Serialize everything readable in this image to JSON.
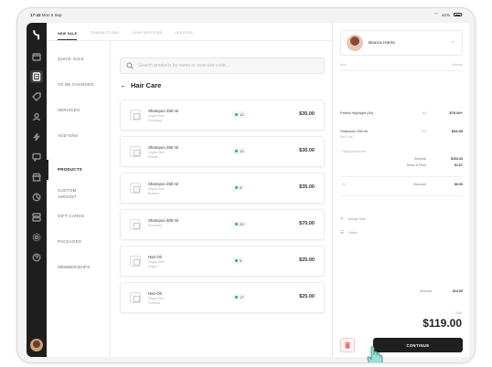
{
  "statusbar": {
    "time": "17:43",
    "date": "Mon 5 Sep",
    "battery": "41%"
  },
  "tabs": [
    {
      "label": "New Sale",
      "active": true
    },
    {
      "label": "Transactions",
      "active": false
    },
    {
      "label": "Cash Register",
      "active": false
    },
    {
      "label": "Invoices",
      "active": false
    }
  ],
  "categories": [
    {
      "label": "Quick Sale",
      "active": false
    },
    {
      "label": "To Be Charged",
      "active": false
    },
    {
      "label": "Services",
      "active": false
    },
    {
      "label": "Add-ons",
      "active": false
    },
    {
      "label": "Products",
      "active": true
    },
    {
      "label": "Custom Amount",
      "active": false
    },
    {
      "label": "Gift Cards",
      "active": false
    },
    {
      "label": "Packages",
      "active": false
    },
    {
      "label": "Memberships",
      "active": false
    }
  ],
  "search": {
    "placeholder": "Search products by name or scan bar code..."
  },
  "section": {
    "back_arrow": "←",
    "title": "Hair Care"
  },
  "products": [
    {
      "name": "Shampoo 250 ml",
      "brand": "Vegan Bee",
      "variant": "Everyday",
      "stock": "12",
      "price": "$35.00"
    },
    {
      "name": "Shampoo 250 ml",
      "brand": "Vegan Bee",
      "variant": "Repair",
      "stock": "10",
      "price": "$35.00"
    },
    {
      "name": "Shampoo 250 ml",
      "brand": "Vegan Bee",
      "variant": "Botanic",
      "stock": "8",
      "price": "$35.00"
    },
    {
      "name": "Shampoo 500 ml",
      "brand": "Everyday",
      "variant": "",
      "stock": "20",
      "price": "$70.00"
    },
    {
      "name": "Hair Oil",
      "brand": "Vegan Bee",
      "variant": "Argan",
      "stock": "6",
      "price": "$25.00"
    },
    {
      "name": "Hair Oil",
      "brand": "Vegan Bee",
      "variant": "Coconut",
      "stock": "17",
      "price": "$25.00"
    }
  ],
  "cart": {
    "client_name": "Bianca Harris",
    "close_glyph": "×",
    "col_item": "Item",
    "col_amount": "Amount",
    "lines": [
      {
        "name": "Partial Highlight (5h)",
        "qty": "x1",
        "amount": "$70.00+",
        "sub": ""
      },
      {
        "name": "Shampoo 250 ml",
        "qty": "x1",
        "amount": "$33.33",
        "sub": "Hair Care"
      }
    ],
    "promo_link": "+ Apply promo/code",
    "summary": [
      {
        "label": "Subtotal",
        "value": "$103.33"
      },
      {
        "label": "Taxes & Fees",
        "value": "$1.67"
      }
    ],
    "discount": {
      "icon": "%",
      "label": "Discount",
      "value": "$0.00"
    },
    "options": [
      {
        "icon": "✎",
        "label": "Assign Sale"
      },
      {
        "icon": "☰",
        "label": "Notes"
      }
    ],
    "subtotal_label": "Subtotal",
    "subtotal_value": "$14.00",
    "total_label": "Total",
    "total": "$119.00",
    "continue_label": "Continue"
  },
  "colors": {
    "rail": "#1e1e1e",
    "stock_dot": "#3aa95b",
    "trash": "#e57373",
    "cursor": "#7fd3c6"
  }
}
